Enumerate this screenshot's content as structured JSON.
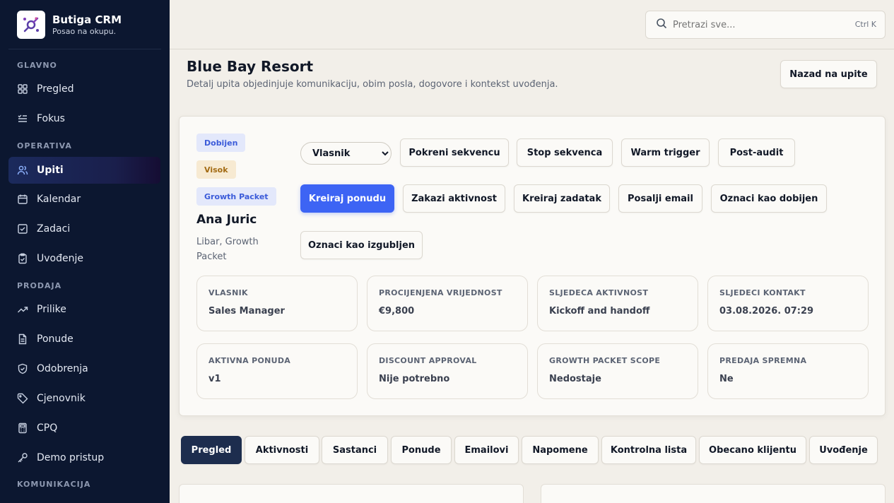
{
  "app": {
    "name": "Butiga CRM",
    "tagline": "Posao na okupu."
  },
  "sidebar": {
    "sections": {
      "main": "GLAVNO",
      "operations": "OPERATIVA",
      "sales": "PRODAJA",
      "communication": "KOMUNIKACIJA"
    },
    "items": [
      {
        "label": "Pregled",
        "icon": "grid-icon"
      },
      {
        "label": "Fokus",
        "icon": "list-check-icon"
      },
      {
        "label": "Upiti",
        "icon": "users-icon",
        "active": true
      },
      {
        "label": "Kalendar",
        "icon": "calendar-icon"
      },
      {
        "label": "Zadaci",
        "icon": "checkbox-icon"
      },
      {
        "label": "Uvođenje",
        "icon": "clipboard-icon"
      },
      {
        "label": "Prilike",
        "icon": "trend-icon"
      },
      {
        "label": "Ponude",
        "icon": "document-icon"
      },
      {
        "label": "Odobrenja",
        "icon": "shield-icon"
      },
      {
        "label": "Cjenovnik",
        "icon": "tag-icon"
      },
      {
        "label": "CPQ",
        "icon": "calculator-icon"
      },
      {
        "label": "Demo pristup",
        "icon": "key-icon"
      }
    ]
  },
  "search": {
    "placeholder": "Pretrazi sve...",
    "shortcut": "Ctrl K"
  },
  "header": {
    "title": "Blue Bay Resort",
    "subtitle": "Detalj upita objedinjuje komunikaciju, obim posla, dogovore i kontekst uvođenja.",
    "back_label": "Nazad na upite"
  },
  "lead": {
    "badges": {
      "stage": "Dobijen",
      "priority": "Visok",
      "product": "Growth Packet"
    },
    "contact_name": "Ana Juric",
    "contact_sub": "Libar, Growth Packet",
    "owner_select": "Vlasnik",
    "actions": {
      "start_sequence": "Pokreni sekvencu",
      "stop_sequence": "Stop sekvenca",
      "warm_trigger": "Warm trigger",
      "post_audit": "Post-audit",
      "create_offer": "Kreiraj ponudu",
      "schedule_activity": "Zakazi aktivnost",
      "create_task": "Kreiraj zadatak",
      "send_email": "Posalji email",
      "mark_won": "Oznaci kao dobijen",
      "mark_lost": "Oznaci kao izgubljen"
    },
    "stats": [
      {
        "label": "VLASNIK",
        "value": "Sales Manager"
      },
      {
        "label": "PROCIJENJENA VRIJEDNOST",
        "value": "€9,800"
      },
      {
        "label": "SLJEDECA AKTIVNOST",
        "value": "Kickoff and handoff"
      },
      {
        "label": "SLJEDECI KONTAKT",
        "value": "03.08.2026. 07:29"
      },
      {
        "label": "AKTIVNA PONUDA",
        "value": "v1"
      },
      {
        "label": "DISCOUNT APPROVAL",
        "value": "Nije potrebno"
      },
      {
        "label": "GROWTH PACKET SCOPE",
        "value": "Nedostaje"
      },
      {
        "label": "PREDAJA SPREMNA",
        "value": "Ne"
      }
    ]
  },
  "tabs": [
    {
      "label": "Pregled",
      "active": true
    },
    {
      "label": "Aktivnosti"
    },
    {
      "label": "Sastanci"
    },
    {
      "label": "Ponude"
    },
    {
      "label": "Emailovi"
    },
    {
      "label": "Napomene"
    },
    {
      "label": "Kontrolna lista"
    },
    {
      "label": "Obecano klijentu"
    },
    {
      "label": "Uvođenje"
    }
  ],
  "colors": {
    "sidebar": "#0c1730",
    "accent": "#3d64f4",
    "active_tab": "#1d2d4e"
  }
}
